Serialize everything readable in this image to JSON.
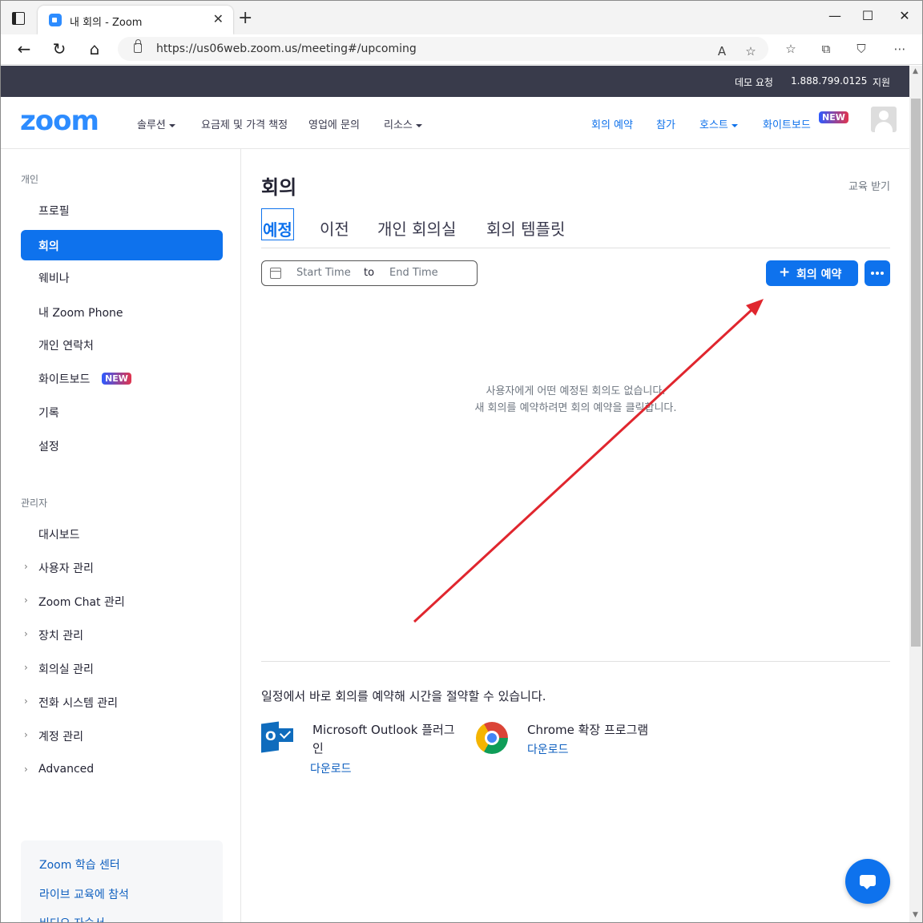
{
  "browser": {
    "tab_title": "내 회의 - Zoom",
    "url": "https://us06web.zoom.us/meeting#/upcoming"
  },
  "top_strip": {
    "demo": "데모 요청",
    "phone": "1.888.799.0125",
    "support": "지원"
  },
  "header": {
    "logo": "zoom",
    "nav_left": [
      "솔루션",
      "요금제 및 가격 책정",
      "영업에 문의",
      "리소스"
    ],
    "nav_right": [
      "회의 예약",
      "참가",
      "호스트",
      "화이트보드"
    ],
    "new_badge": "NEW"
  },
  "sidebar": {
    "personal_label": "개인",
    "personal_items": [
      "프로필",
      "회의",
      "웨비나",
      "내 Zoom Phone",
      "개인 연락처",
      "화이트보드",
      "기록",
      "설정"
    ],
    "active_item": "회의",
    "new_badge": "NEW",
    "admin_label": "관리자",
    "admin_items": [
      "대시보드",
      "사용자 관리",
      "Zoom Chat 관리",
      "장치 관리",
      "회의실 관리",
      "전화 시스템 관리",
      "계정 관리",
      "Advanced"
    ],
    "learn_links": [
      "Zoom 학습 센터",
      "라이브 교육에 참석",
      "비디오 자습서"
    ]
  },
  "main": {
    "title": "회의",
    "training": "교육 받기",
    "tabs": [
      "예정",
      "이전",
      "개인 회의실",
      "회의 템플릿"
    ],
    "active_tab": "예정",
    "start_placeholder": "Start Time",
    "to_label": "to",
    "end_placeholder": "End Time",
    "schedule_button": "회의 예약",
    "empty_line1": "사용자에게 어떤 예정된 회의도 없습니다.",
    "empty_line2": "새 회의를 예약하려면 회의 예약을 클릭합니다.",
    "promo_title": "일정에서 바로 회의를 예약해 시간을 절약할 수 있습니다.",
    "outlook_name_line1": "Microsoft Outlook 플러그",
    "outlook_name_line2": "인",
    "outlook_download": "다운로드",
    "chrome_name": "Chrome 확장 프로그램",
    "chrome_download": "다운로드"
  },
  "colors": {
    "brand_blue": "#0e72ed",
    "top_strip": "#393b4b",
    "annotation_arrow": "#e0262e"
  }
}
